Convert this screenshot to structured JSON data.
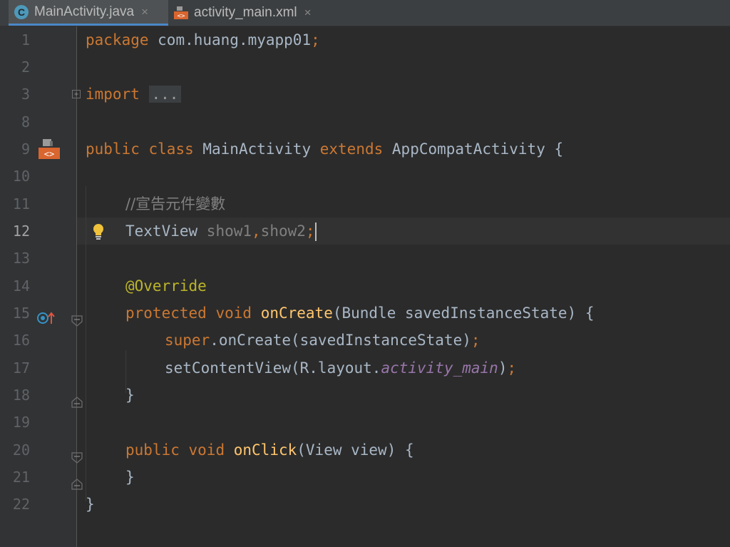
{
  "tabs": [
    {
      "label": "MainActivity.java",
      "icon": "java-class-icon",
      "active": true,
      "close": "×"
    },
    {
      "label": "activity_main.xml",
      "icon": "xml-layout-icon",
      "active": false,
      "close": "×"
    }
  ],
  "editor": {
    "current_line": "12",
    "lines": [
      {
        "n": "1"
      },
      {
        "n": "2"
      },
      {
        "n": "3"
      },
      {
        "n": "8"
      },
      {
        "n": "9"
      },
      {
        "n": "10"
      },
      {
        "n": "11"
      },
      {
        "n": "12"
      },
      {
        "n": "13"
      },
      {
        "n": "14"
      },
      {
        "n": "15"
      },
      {
        "n": "16"
      },
      {
        "n": "17"
      },
      {
        "n": "18"
      },
      {
        "n": "19"
      },
      {
        "n": "20"
      },
      {
        "n": "21"
      },
      {
        "n": "22"
      }
    ],
    "code": {
      "l1_kw": "package",
      "l1_rest": " com.huang.myapp01",
      "l1_semi": ";",
      "l3_kw": "import",
      "l3_fold": "...",
      "l9_kw1": "public",
      "l9_kw2": "class",
      "l9_name": " MainActivity ",
      "l9_kw3": "extends",
      "l9_rest": " AppCompatActivity {",
      "l11_comment": "//宣告元件變數",
      "l12_type": "TextView ",
      "l12_var1": "show1",
      "l12_comma": ",",
      "l12_var2": "show2",
      "l12_semi": ";",
      "l14_ann": "@Override",
      "l15_kw1": "protected",
      "l15_kw2": "void",
      "l15_fn": "onCreate",
      "l15_rest": "(Bundle savedInstanceState) {",
      "l16_kw": "super",
      "l16_rest": ".onCreate(savedInstanceState)",
      "l16_semi": ";",
      "l17_pre": "setContentView(R.layout.",
      "l17_ital": "activity_main",
      "l17_post": ")",
      "l17_semi": ";",
      "l18": "}",
      "l20_kw1": "public",
      "l20_kw2": "void",
      "l20_fn": "onClick",
      "l20_rest": "(View view) {",
      "l21": "}",
      "l22": "}"
    }
  },
  "gutter_icons": {
    "line9": "xml-layout-icon",
    "line12": "lightbulb-icon",
    "line15": "override-method-icon"
  },
  "colors": {
    "background": "#2b2b2b",
    "keyword": "#cc7832",
    "function": "#ffc66d",
    "annotation": "#bbb529",
    "text": "#a9b7c6",
    "comment": "#808080",
    "field": "#9876aa",
    "tab_underline": "#4a88c7"
  }
}
